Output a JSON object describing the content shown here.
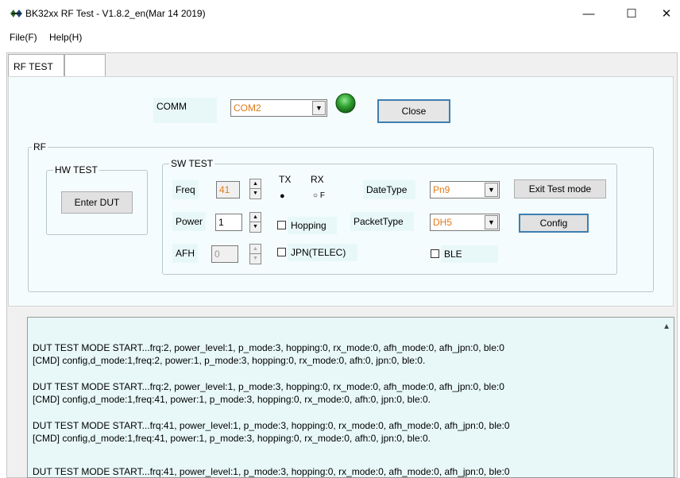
{
  "window": {
    "title": "BK32xx RF Test - V1.8.2_en(Mar 14 2019)",
    "minimize": "—",
    "maximize": "☐",
    "close": "✕"
  },
  "menu": {
    "file": "File(F)",
    "help": "Help(H)"
  },
  "tabs": [
    {
      "label": "RF TEST"
    },
    {
      "label": ""
    }
  ],
  "comm": {
    "label": "COMM",
    "port": "COM2",
    "status_color": "#2e9e2e",
    "close_button": "Close"
  },
  "rf": {
    "label": "RF"
  },
  "hw_test": {
    "label": "HW TEST",
    "enter_dut": "Enter DUT"
  },
  "sw_test": {
    "label": "SW TEST",
    "freq_label": "Freq",
    "freq_value": "41",
    "power_label": "Power",
    "power_value": "1",
    "afh_label": "AFH",
    "afh_value": "0",
    "tx_label": "TX",
    "rx_label": "RX",
    "rx_radio_text": "F",
    "hopping_label": "Hopping",
    "jpn_label": "JPN(TELEC)",
    "datetype_label": "DateType",
    "datetype_value": "Pn9",
    "packettype_label": "PacketType",
    "packettype_value": "DH5",
    "ble_label": "BLE",
    "exit_test_mode": "Exit Test mode",
    "config": "Config"
  },
  "log": [
    "DUT TEST MODE START...frq:2, power_level:1, p_mode:3, hopping:0, rx_mode:0, afh_mode:0, afh_jpn:0, ble:0",
    "[CMD] config,d_mode:1,freq:2, power:1, p_mode:3, hopping:0, rx_mode:0, afh:0, jpn:0, ble:0.",
    "DUT TEST MODE START...frq:2, power_level:1, p_mode:3, hopping:0, rx_mode:0, afh_mode:0, afh_jpn:0, ble:0",
    "[CMD] config,d_mode:1,freq:41, power:1, p_mode:3, hopping:0, rx_mode:0, afh:0, jpn:0, ble:0.",
    "DUT TEST MODE START...frq:41, power_level:1, p_mode:3, hopping:0, rx_mode:0, afh_mode:0, afh_jpn:0, ble:0",
    "[CMD] config,d_mode:1,freq:41, power:1, p_mode:3, hopping:0, rx_mode:0, afh:0, jpn:0, ble:0.",
    "DUT TEST MODE START...frq:41, power_level:1, p_mode:3, hopping:0, rx_mode:0, afh_mode:0, afh_jpn:0, ble:0"
  ]
}
